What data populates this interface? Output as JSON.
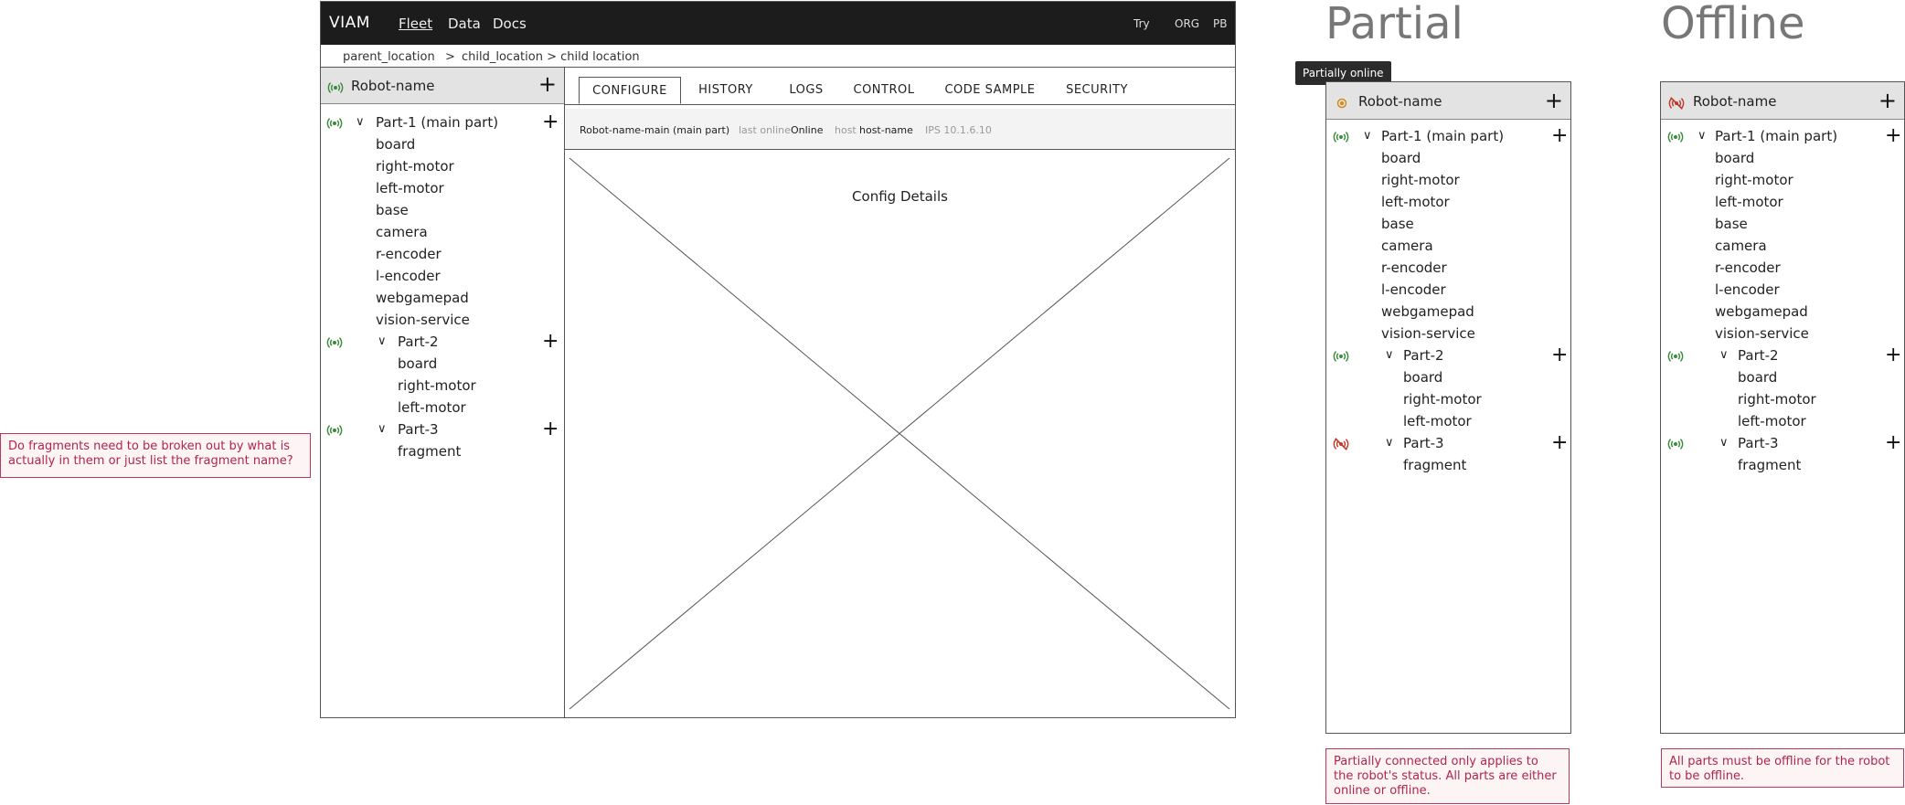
{
  "topbar": {
    "logo": "VIAM",
    "nav": [
      "Fleet",
      "Data",
      "Docs"
    ],
    "right": [
      "Try",
      "ORG",
      "PB"
    ]
  },
  "breadcrumb": {
    "parent": "parent_location",
    "sep1": ">",
    "child": "child_location > child location"
  },
  "robot": {
    "name": "Robot-name",
    "part1": {
      "label": "Part-1 (main part)",
      "components": [
        "board",
        "right-motor",
        "left-motor",
        "base",
        "camera",
        "r-encoder",
        "l-encoder",
        "webgamepad",
        "vision-service"
      ]
    },
    "part2": {
      "label": "Part-2",
      "components": [
        "board",
        "right-motor",
        "left-motor"
      ]
    },
    "part3": {
      "label": "Part-3",
      "components": [
        "fragment"
      ]
    }
  },
  "tabs": [
    "CONFIGURE",
    "HISTORY",
    "LOGS",
    "CONTROL",
    "CODE SAMPLE",
    "SECURITY"
  ],
  "info": {
    "name": "Robot-name-main (main part)",
    "last_online_label": "last online",
    "last_online_value": "Online",
    "host_label": "host",
    "host_value": "host-name",
    "ips": "IPS 10.1.6.10"
  },
  "config_placeholder": "Config Details",
  "variants": {
    "partial": {
      "heading": "Partial",
      "tooltip": "Partially online"
    },
    "offline": {
      "heading": "Offline"
    }
  },
  "notes": {
    "fragments": "Do fragments need to be broken out by what is actually in them or just list the fragment name?",
    "partial": "Partially connected only applies to the robot's status. All parts are either online or offline.",
    "offline": "All parts must be offline for the robot to be offline."
  },
  "colors": {
    "online": "#3a8a3a",
    "offline": "#c0392b",
    "partial": "#d68a1a",
    "note": "#b0264b"
  },
  "icons": {
    "online": "online-signal-icon",
    "offline": "offline-signal-icon",
    "partial": "partial-signal-icon"
  }
}
